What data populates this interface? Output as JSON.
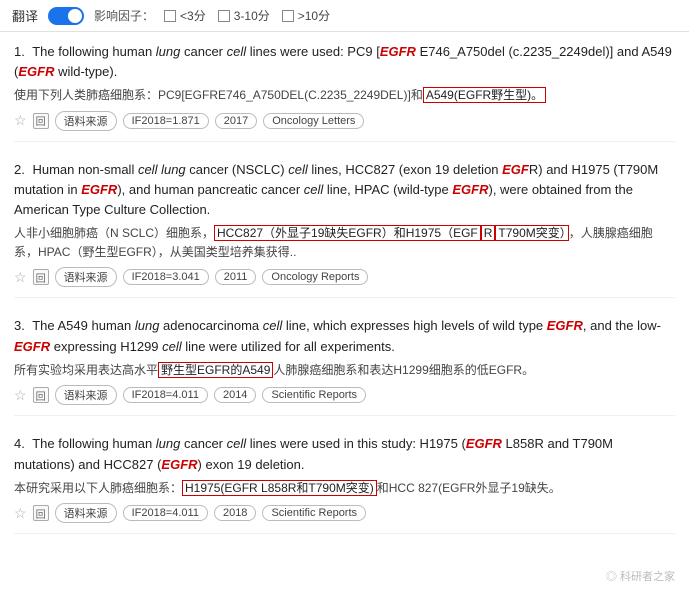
{
  "topbar": {
    "translate_label": "翻译",
    "impact_label": "影响因子：",
    "filter1_label": "<3分",
    "filter2_label": "3-10分",
    "filter3_label": ">10分"
  },
  "results": [
    {
      "number": "1.",
      "text_en_parts": [
        {
          "t": "The following human ",
          "s": "normal"
        },
        {
          "t": "lung",
          "s": "italic"
        },
        {
          "t": " cancer ",
          "s": "normal"
        },
        {
          "t": "cell",
          "s": "italic"
        },
        {
          "t": " lines were used: PC9 [",
          "s": "normal"
        },
        {
          "t": "EGFR",
          "s": "red-italic"
        },
        {
          "t": " E746_A750del (c.2235_2249del)] and A549 (",
          "s": "normal"
        },
        {
          "t": "EGFR",
          "s": "red-italic"
        },
        {
          "t": " wild-type).",
          "s": "normal"
        }
      ],
      "text_zh": "使用下列人类肺癌细胞系：PC9[EGFRE746_A750DEL(C.2235_2249DEL)]和",
      "text_zh_highlight": "A549(EGFR野生型)。",
      "text_zh_after": "",
      "if_value": "IF2018=1.871",
      "year": "2017",
      "journal": "Oncology Letters"
    },
    {
      "number": "2.",
      "text_en_parts": [
        {
          "t": "Human non-small ",
          "s": "normal"
        },
        {
          "t": "cell lung",
          "s": "italic"
        },
        {
          "t": " cancer (NSCLC) ",
          "s": "normal"
        },
        {
          "t": "cell",
          "s": "italic"
        },
        {
          "t": " lines, HCC827 (exon 19 deletion ",
          "s": "normal"
        },
        {
          "t": "EGF",
          "s": "red-italic"
        },
        {
          "t": "R) and H1975 (T790M mutation in ",
          "s": "normal"
        },
        {
          "t": "EGFR",
          "s": "red-italic"
        },
        {
          "t": "), and human pancreatic cancer ",
          "s": "normal"
        },
        {
          "t": "cell",
          "s": "italic"
        },
        {
          "t": " line, HPAC (wild-type ",
          "s": "normal"
        },
        {
          "t": "EGFR",
          "s": "red-italic"
        },
        {
          "t": "), were obtained from the American Type Culture Collection.",
          "s": "normal"
        }
      ],
      "text_zh_before": "人非小细胞肺癌（N SCLC）细胞系，",
      "text_zh_highlight1": "HCC827（外显子19缺失EGFR）和H1975（EGF",
      "text_zh_mid": "R",
      "text_zh_highlight2": "T790M突变）",
      "text_zh_after": "，人胰腺癌细胞系，HPAC（野生型EGFR），从美国类型培养集获得..",
      "if_value": "IF2018=3.041",
      "year": "2011",
      "journal": "Oncology Reports"
    },
    {
      "number": "3.",
      "text_en_parts": [
        {
          "t": "The A549 human ",
          "s": "normal"
        },
        {
          "t": "lung",
          "s": "italic"
        },
        {
          "t": " adenocarcinoma ",
          "s": "normal"
        },
        {
          "t": "cell",
          "s": "italic"
        },
        {
          "t": " line, which expresses high levels of wild type ",
          "s": "normal"
        },
        {
          "t": "EGFR",
          "s": "red-italic"
        },
        {
          "t": ", and the low-",
          "s": "normal"
        },
        {
          "t": "EGFR",
          "s": "red-italic"
        },
        {
          "t": " expressing H1299 ",
          "s": "normal"
        },
        {
          "t": "cell",
          "s": "italic"
        },
        {
          "t": " line were utilized for all experiments.",
          "s": "normal"
        }
      ],
      "text_zh_before": "所有实验均采用表达高水平",
      "text_zh_highlight": "野生型EGFR的A549",
      "text_zh_after": "人肺腺癌细胞系和表达H1299细胞系的低EGFR。",
      "if_value": "IF2018=4.011",
      "year": "2014",
      "journal": "Scientific Reports"
    },
    {
      "number": "4.",
      "text_en_parts": [
        {
          "t": "The following human ",
          "s": "normal"
        },
        {
          "t": "lung",
          "s": "italic"
        },
        {
          "t": " cancer ",
          "s": "normal"
        },
        {
          "t": "cell",
          "s": "italic"
        },
        {
          "t": " lines were used in this study: H1975 (",
          "s": "normal"
        },
        {
          "t": "EGFR",
          "s": "red-italic"
        },
        {
          "t": " L858R and T790M mutations) and HCC827 (",
          "s": "normal"
        },
        {
          "t": "EGFR",
          "s": "red-italic"
        },
        {
          "t": ") exon 19 deletion.",
          "s": "normal"
        }
      ],
      "text_zh_before": "本研究采用以下人肺癌细胞系：",
      "text_zh_highlight": "H1975(EGFR L858R和T790M突变)",
      "text_zh_after": "和HCC 827(EGFR外显子19缺失。",
      "if_value": "IF2018=4.011",
      "year": "2018",
      "journal": "Scientific Reports"
    }
  ],
  "watermark": "◎ 科研者之家"
}
